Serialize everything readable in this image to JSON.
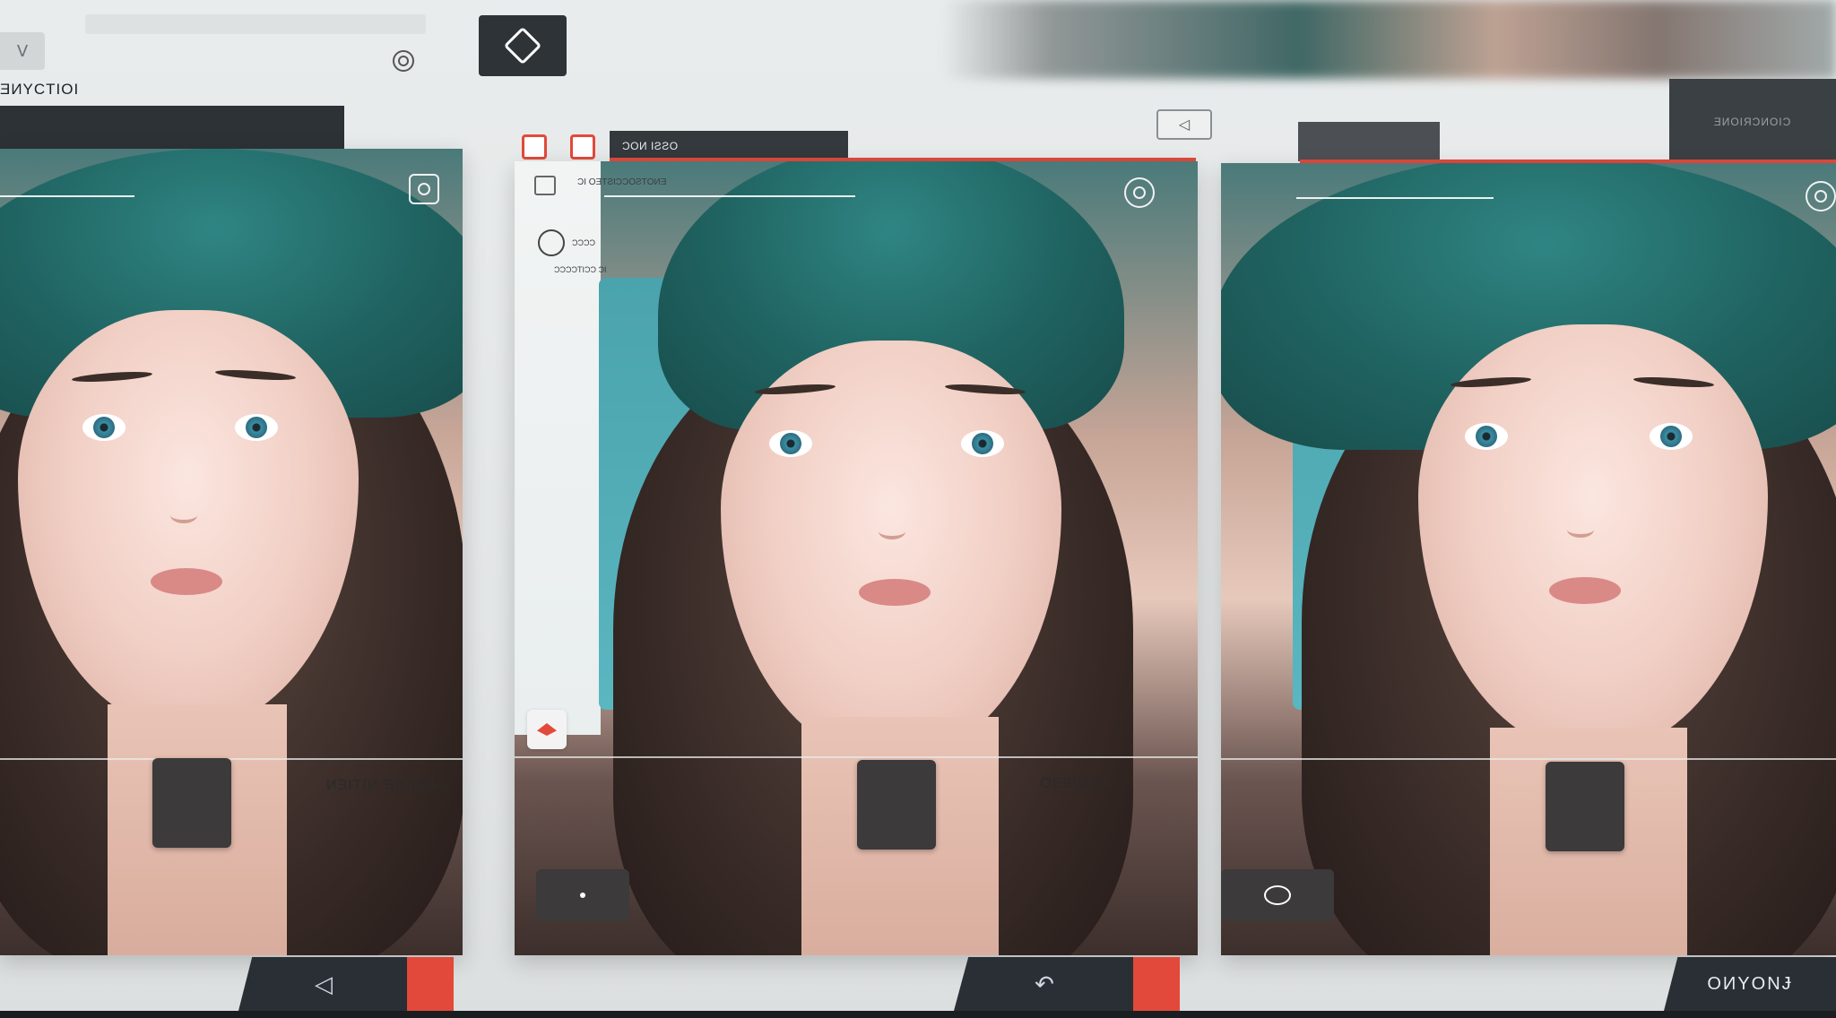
{
  "top": {
    "section_title": "ƎИYCTIOI",
    "corner_tab_glyph": "ᐯ",
    "small_box_glyph": "◁",
    "far_right_box_text": "ƎИOIЯƆИOIƆ"
  },
  "card1": {
    "caption": "ИƎITIИ ƁIUIƁAl",
    "back_glyph": "◁"
  },
  "card2": {
    "tab_label": "ƆOИ IƧƧO",
    "panel_title": "ƆI OƎΤƧIƆƆOƧΤOИƎ",
    "panel_sub": "ƆƆƆƆ",
    "panel_sub2": "ƆƆƆƆΤIƆƆ ƆI",
    "caption": "OEBIOЯA",
    "undo_glyph": "↶"
  },
  "card3": {
    "corner_text": "OИYONɈ"
  },
  "colors": {
    "accent_red": "#e2493a",
    "teal": "#1f6260",
    "dark": "#2e3338"
  }
}
